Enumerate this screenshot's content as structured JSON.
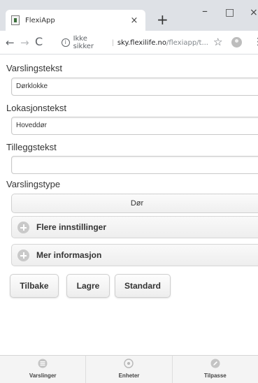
{
  "browser": {
    "tab_title": "FlexiApp",
    "tab_close": "×",
    "new_tab": "+",
    "window_controls": {
      "minimize": "–",
      "maximize": "□",
      "close": "×"
    },
    "nav": {
      "back": "←",
      "forward": "→",
      "reload": "C"
    },
    "address": {
      "info_icon": "i",
      "security_text": "Ikke sikker",
      "separator": "|",
      "host": "sky.flexilife.no",
      "path": "/flexiapp/t..."
    },
    "star": "☆",
    "menu": "⋮"
  },
  "form": {
    "fields": [
      {
        "label": "Varslingstekst",
        "value": "Dørklokke"
      },
      {
        "label": "Lokasjonstekst",
        "value": "Hoveddør"
      },
      {
        "label": "Tilleggstekst",
        "value": ""
      }
    ],
    "type_label": "Varslingstype",
    "type_value": "Dør"
  },
  "sections": [
    {
      "title": "Flere innstillinger"
    },
    {
      "title": "Mer informasjon"
    }
  ],
  "buttons": {
    "back": "Tilbake",
    "save": "Lagre",
    "default": "Standard"
  },
  "bottom_nav": [
    {
      "label": "Varslinger",
      "icon": "list-icon"
    },
    {
      "label": "Enheter",
      "icon": "device-icon"
    },
    {
      "label": "Tilpasse",
      "icon": "pencil-icon"
    }
  ]
}
